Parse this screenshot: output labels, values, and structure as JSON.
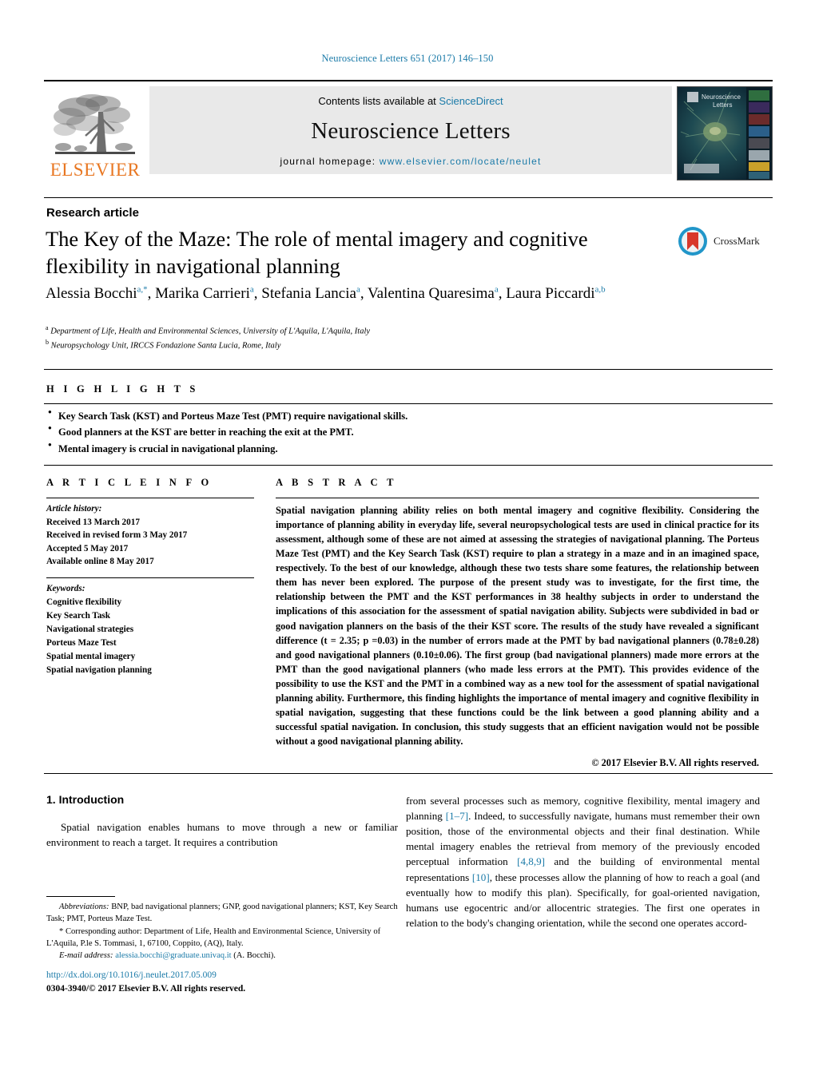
{
  "running_head": "Neuroscience Letters 651 (2017) 146–150",
  "masthead": {
    "publisher_name": "ELSEVIER",
    "contents_prefix": "Contents lists available at ",
    "contents_link": "ScienceDirect",
    "journal_name": "Neuroscience Letters",
    "homepage_prefix": "journal homepage: ",
    "homepage_url": "www.elsevier.com/locate/neulet",
    "cover_title_line1": "Neuroscience",
    "cover_title_line2": "Letters"
  },
  "article": {
    "type": "Research article",
    "title": "The Key of the Maze: The role of mental imagery and cognitive flexibility in navigational planning",
    "crossmark_label": "CrossMark",
    "authors": [
      {
        "name": "Alessia Bocchi",
        "marks": "a,*"
      },
      {
        "name": "Marika Carrieri",
        "marks": "a"
      },
      {
        "name": "Stefania Lancia",
        "marks": "a"
      },
      {
        "name": "Valentina Quaresima",
        "marks": "a"
      },
      {
        "name": "Laura Piccardi",
        "marks": "a,b"
      }
    ],
    "affiliations": [
      {
        "mark": "a",
        "text": "Department of Life, Health and Environmental Sciences, University of L'Aquila, L'Aquila, Italy"
      },
      {
        "mark": "b",
        "text": "Neuropsychology Unit, IRCCS Fondazione Santa Lucia, Rome, Italy"
      }
    ]
  },
  "highlights": {
    "heading": "H I G H L I G H T S",
    "items": [
      "Key Search Task (KST) and Porteus Maze Test (PMT) require navigational skills.",
      "Good planners at the KST are better in reaching the exit at the PMT.",
      "Mental imagery is crucial in navigational planning."
    ]
  },
  "article_info": {
    "heading": "A R T I C L E   I N F O",
    "history_label": "Article history:",
    "history": [
      "Received 13 March 2017",
      "Received in revised form 3 May 2017",
      "Accepted 5 May 2017",
      "Available online 8 May 2017"
    ],
    "keywords_label": "Keywords:",
    "keywords": [
      "Cognitive flexibility",
      "Key Search Task",
      "Navigational strategies",
      "Porteus Maze Test",
      "Spatial mental imagery",
      "Spatial navigation planning"
    ]
  },
  "abstract": {
    "heading": "A B S T R A C T",
    "text": "Spatial navigation planning ability relies on both mental imagery and cognitive flexibility. Considering the importance of planning ability in everyday life, several neuropsychological tests are used in clinical practice for its assessment, although some of these are not aimed at assessing the strategies of navigational planning. The Porteus Maze Test (PMT) and the Key Search Task (KST) require to plan a strategy in a maze and in an imagined space, respectively. To the best of our knowledge, although these two tests share some features, the relationship between them has never been explored. The purpose of the present study was to investigate, for the first time, the relationship between the PMT and the KST performances in 38 healthy subjects in order to understand the implications of this association for the assessment of spatial navigation ability. Subjects were subdivided in bad or good navigation planners on the basis of the their KST score. The results of the study have revealed a significant difference (t = 2.35; p =0.03) in the number of errors made at the PMT by bad navigational planners (0.78±0.28) and good navigational planners (0.10±0.06). The first group (bad navigational planners) made more errors at the PMT than the good navigational planners (who made less errors at the PMT). This provides evidence of the possibility to use the KST and the PMT in a combined way as a new tool for the assessment of spatial navigational planning ability. Furthermore, this finding highlights the importance of mental imagery and cognitive flexibility in spatial navigation, suggesting that these functions could be the link between a good planning ability and a successful spatial navigation. In conclusion, this study suggests that an efficient navigation would not be possible without a good navigational planning ability.",
    "copyright": "© 2017 Elsevier B.V. All rights reserved."
  },
  "introduction": {
    "heading": "1.  Introduction",
    "left_paragraph": "Spatial navigation enables humans to move through a new or familiar environment to reach a target. It requires a contribution",
    "right_part_1": "from several processes such as memory, cognitive flexibility, mental imagery and planning ",
    "ref_1": "[1–7]",
    "right_part_2": ". Indeed, to successfully navigate, humans must remember their own position, those of the environmental objects and their final destination. While mental imagery enables the retrieval from memory of the previously encoded perceptual information ",
    "ref_2": "[4,8,9]",
    "right_part_3": " and the building of environmental mental representations ",
    "ref_3": "[10]",
    "right_part_4": ", these processes allow the planning of how to reach a goal (and eventually how to modify this plan). Specifically, for goal-oriented navigation, humans use egocentric and/or allocentric strategies. The first one operates in relation to the body's changing orientation, while the second one operates accord-"
  },
  "footnotes": {
    "abbreviations_label": "Abbreviations:",
    "abbreviations_text": " BNP, bad navigational planners; GNP, good navigational planners; KST, Key Search Task; PMT, Porteus Maze Test.",
    "corresponding_marker": "*",
    "corresponding_text": " Corresponding author: Department of Life, Health and Environmental Science, University of L'Aquila, P.le S. Tommasi, 1, 67100, Coppito, (AQ), Italy.",
    "email_label": "E-mail address:",
    "email": "alessia.bocchi@graduate.univaq.it",
    "email_suffix": " (A. Bocchi).",
    "doi": "http://dx.doi.org/10.1016/j.neulet.2017.05.009",
    "issn": "0304-3940/© 2017 Elsevier B.V. All rights reserved."
  }
}
